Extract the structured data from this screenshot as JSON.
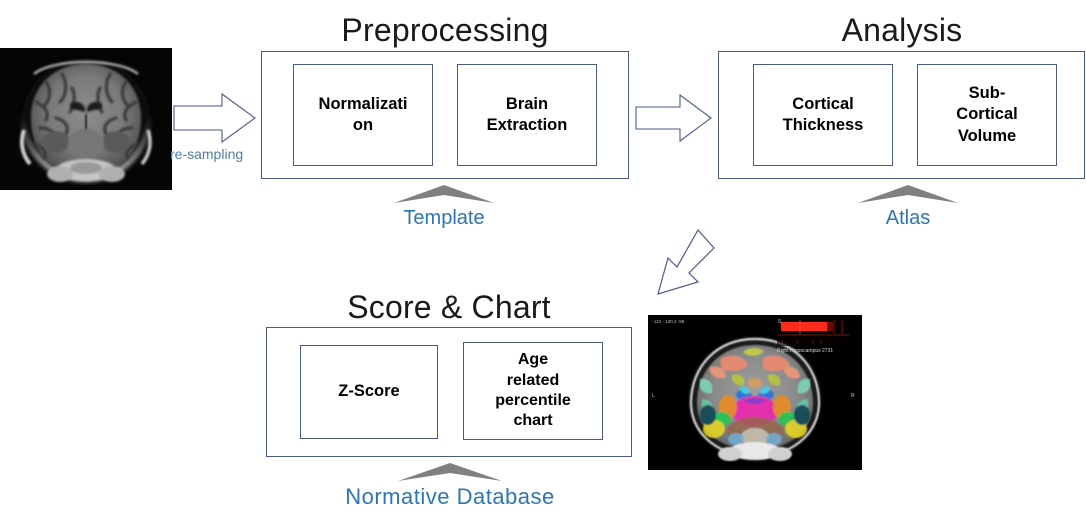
{
  "sections": {
    "preprocessing": {
      "title": "Preprocessing",
      "steps": [
        {
          "name": "normalization",
          "lines": [
            "Normalizati",
            "on"
          ]
        },
        {
          "name": "brain-extraction",
          "lines": [
            "Brain",
            "Extraction"
          ]
        }
      ],
      "support_label": "Template"
    },
    "analysis": {
      "title": "Analysis",
      "steps": [
        {
          "name": "cortical-thickness",
          "lines": [
            "Cortical",
            "Thickness"
          ]
        },
        {
          "name": "sub-cortical-volume",
          "lines": [
            "Sub-",
            "Cortical",
            "Volume"
          ]
        }
      ],
      "support_label": "Atlas"
    },
    "score_chart": {
      "title": "Score & Chart",
      "steps": [
        {
          "name": "z-score",
          "lines": [
            "Z-Score"
          ]
        },
        {
          "name": "age-percentile-chart",
          "lines": [
            "Age",
            "related",
            "percentile",
            "chart"
          ]
        }
      ],
      "support_label": "Normative  Database"
    }
  },
  "arrows": {
    "input_to_preprocessing": {
      "label": "re-sampling",
      "direction": "right"
    },
    "preprocessing_to_analysis": {
      "label": "",
      "direction": "right"
    },
    "analysis_to_score": {
      "label": "",
      "direction": "down-left"
    }
  },
  "images": {
    "input_mri": {
      "name": "coronal-t1-mri",
      "caption": ""
    },
    "segmented_mri": {
      "name": "segmented-coronal-mri",
      "overlay": {
        "top_left": "- 121 - 130.2 -86",
        "superior": "S",
        "left": "L",
        "right": "R",
        "structure_label": "Right Hippocampus 2731",
        "scale_values": "0 4 10"
      }
    }
  },
  "colors": {
    "box_border": "#4a5a8a",
    "title_text": "#1a1a1a",
    "accent_blue": "#2e75b6",
    "chevron_gray": "#808080",
    "arrow_outline": "#4a5a8a",
    "background": "#ffffff"
  }
}
